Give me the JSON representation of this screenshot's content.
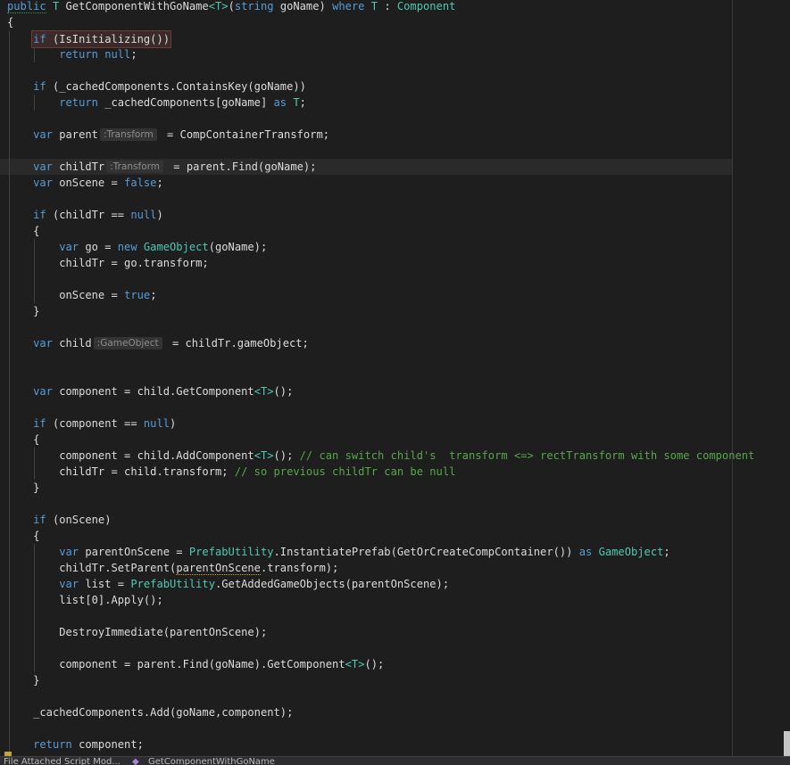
{
  "colors": {
    "background": "#1e1e1e",
    "keyword": "#569cd6",
    "type": "#4ec9b0",
    "comment": "#57a64a",
    "text": "#dcdcdc"
  },
  "code": {
    "line01": {
      "public": "public",
      "t1": "T",
      "name": "GetComponentWithGoName",
      "lt": "<",
      "t2": "T",
      "gt": ">",
      "open": "(",
      "string": "string",
      "param": "goName)",
      "where": "where",
      "t3": "T",
      "colon": ":",
      "component": "Component"
    },
    "line02": {
      "brace": "{"
    },
    "line03": {
      "if": "if",
      "cond": "(IsInitializing())"
    },
    "line04": {
      "return": "return",
      "null": "null",
      "semi": ";"
    },
    "line06": {
      "if": "if",
      "cond": "(_cachedComponents.ContainsKey(goName))"
    },
    "line07": {
      "return": "return",
      "expr": "_cachedComponents[goName]",
      "as": "as",
      "t": "T",
      "semi": ";"
    },
    "line09": {
      "var": "var",
      "name": "parent",
      "hint": ":Transform",
      "rest": "= CompContainerTransform;"
    },
    "line11": {
      "var": "var",
      "name": "childTr",
      "hint": ":Transform",
      "rest": "= parent.Find(goName);"
    },
    "line12": {
      "var": "var",
      "name": "onScene =",
      "false": "false",
      "semi": ";"
    },
    "line14": {
      "if": "if",
      "cond": "(childTr ==",
      "null": "null",
      "close": ")"
    },
    "line15": {
      "brace": "{"
    },
    "line16": {
      "var": "var",
      "mid": "go =",
      "new": "new",
      "type": "GameObject",
      "rest": "(goName);"
    },
    "line17": {
      "text": "childTr = go.transform;"
    },
    "line19": {
      "text": "onScene =",
      "true": "true",
      "semi": ";"
    },
    "line20": {
      "brace": "}"
    },
    "line22": {
      "var": "var",
      "name": "child",
      "hint": ":GameObject",
      "rest": "= childTr.gameObject;"
    },
    "line25": {
      "var": "var",
      "mid": "component = child.GetComponent",
      "lt": "<",
      "t": "T",
      "gt": ">",
      "rest": "();"
    },
    "line27": {
      "if": "if",
      "cond": "(component ==",
      "null": "null",
      "close": ")"
    },
    "line28": {
      "brace": "{"
    },
    "line29": {
      "mid": "component = child.AddComponent",
      "lt": "<",
      "t": "T",
      "gt": ">",
      "rest": "();",
      "comment": "// can switch child's  transform <=> rectTransform with some component"
    },
    "line30": {
      "text": "childTr = child.transform;",
      "comment": "// so previous childTr can be null"
    },
    "line31": {
      "brace": "}"
    },
    "line33": {
      "if": "if",
      "cond": "(onScene)"
    },
    "line34": {
      "brace": "{"
    },
    "line35": {
      "var": "var",
      "mid": "parentOnScene =",
      "type": "PrefabUtility",
      "call": ".InstantiatePrefab(GetOrCreateCompContainer())",
      "as": "as",
      "type2": "GameObject",
      "semi": ";"
    },
    "line36": {
      "pre": "childTr.SetParent(",
      "squig": "parentOnScene",
      "post": ".transform);"
    },
    "line37": {
      "var": "var",
      "mid": "list =",
      "type": "PrefabUtility",
      "rest": ".GetAddedGameObjects(parentOnScene);"
    },
    "line38": {
      "text": "list[0].Apply();"
    },
    "line40": {
      "text": "DestroyImmediate(parentOnScene);"
    },
    "line42": {
      "mid": "component = parent.Find(goName).GetComponent",
      "lt": "<",
      "t": "T",
      "gt": ">",
      "rest": "();"
    },
    "line43": {
      "brace": "}"
    },
    "line45": {
      "text": "_cachedComponents.Add(goName,component);"
    },
    "line47": {
      "return": "return",
      "rest": "component;"
    }
  },
  "statusbar": {
    "file": "File Attached Script Mod...",
    "method": "GetComponentWithGoName"
  }
}
